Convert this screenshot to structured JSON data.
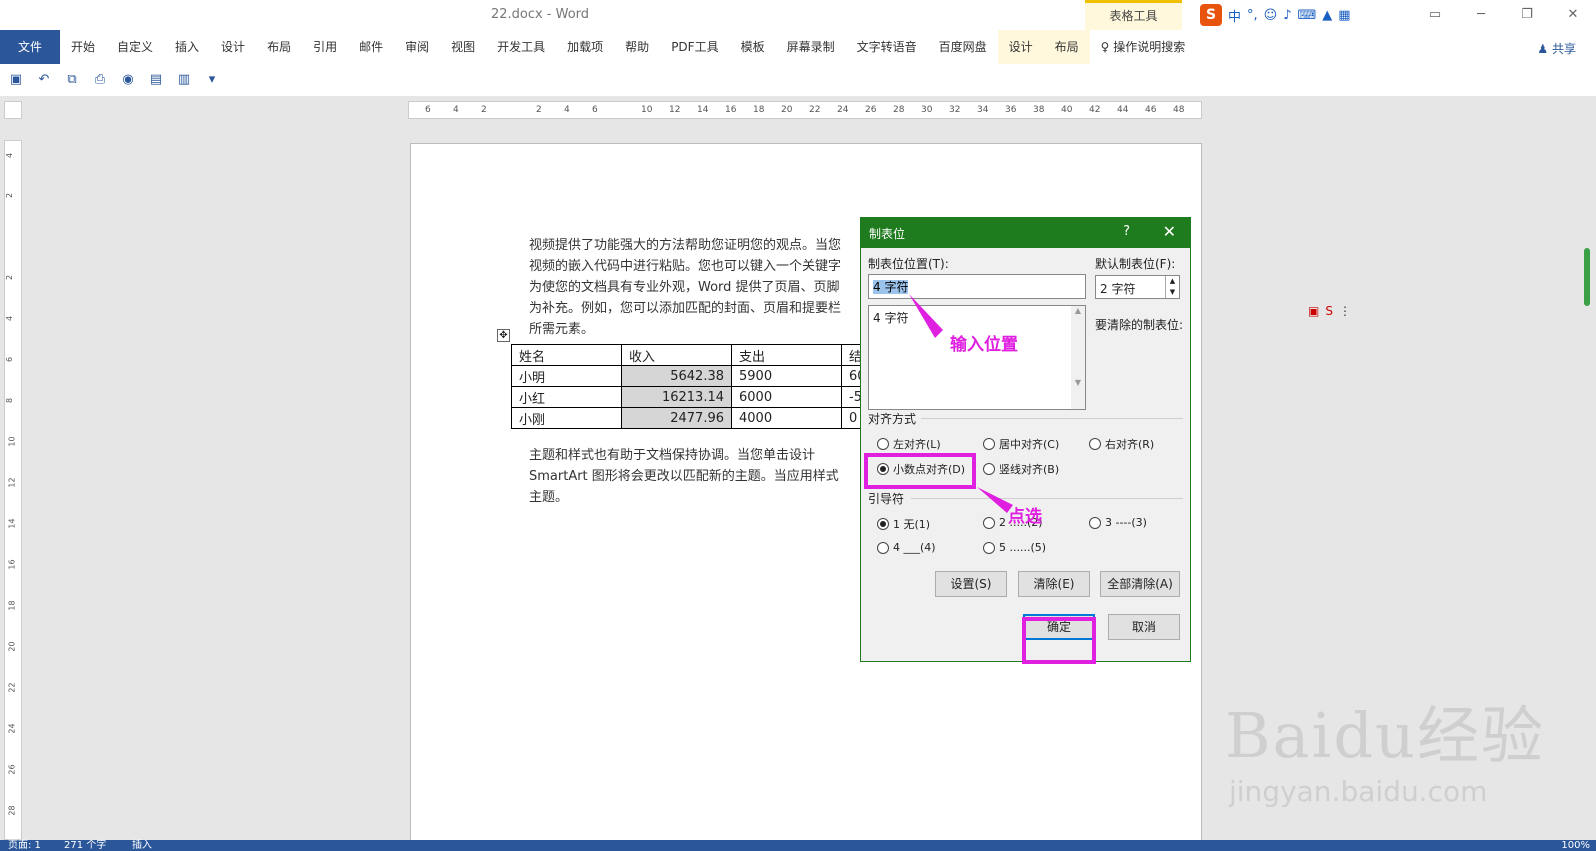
{
  "window": {
    "title": "22.docx  -  Word",
    "context_group": "表格工具"
  },
  "ribbon": {
    "tabs": [
      "文件",
      "开始",
      "自定义",
      "插入",
      "设计",
      "布局",
      "引用",
      "邮件",
      "审阅",
      "视图",
      "开发工具",
      "加载项",
      "帮助",
      "PDF工具",
      "模板",
      "屏幕录制",
      "文字转语音",
      "百度网盘",
      "设计",
      "布局"
    ],
    "tell_me": "操作说明搜索",
    "share": "共享"
  },
  "ime": {
    "mode": "中",
    "punct": "°,"
  },
  "ruler": {
    "h_ticks": [
      "6",
      "4",
      "2",
      "2",
      "4",
      "6",
      "10",
      "12",
      "14",
      "16",
      "18",
      "20",
      "22",
      "24",
      "26",
      "28",
      "30",
      "32",
      "34",
      "36",
      "38",
      "40",
      "42",
      "44",
      "46",
      "48"
    ],
    "v_ticks": [
      "4",
      "2",
      "2",
      "4",
      "6",
      "8",
      "10",
      "12",
      "14",
      "16",
      "18",
      "20",
      "22",
      "24",
      "26",
      "28"
    ]
  },
  "document": {
    "para1": [
      "视频提供了功能强大的方法帮助您证明您的观点。当您",
      "视频的嵌入代码中进行粘贴。您也可以键入一个关键字",
      "为使您的文档具有专业外观，Word 提供了页眉、页脚",
      "为补充。例如，您可以添加匹配的封面、页眉和提要栏",
      "所需元素。"
    ],
    "table": {
      "headers": [
        "姓名",
        "收入",
        "支出",
        "结"
      ],
      "rows": [
        [
          "小明",
          "5642.38",
          "5900",
          "60"
        ],
        [
          "小红",
          "16213.14",
          "6000",
          "-5"
        ],
        [
          "小刚",
          "2477.96",
          "4000",
          "0"
        ]
      ]
    },
    "para2": [
      "主题和样式也有助于文档保持协调。当您单击设计",
      "SmartArt 图形将会更改以匹配新的主题。当应用样式",
      "主题。"
    ]
  },
  "dialog": {
    "title": "制表位",
    "help": "?",
    "close": "✕",
    "tab_position_label": "制表位位置(T):",
    "tab_position_value": "4 字符",
    "tab_list": [
      "4 字符"
    ],
    "default_tab_label": "默认制表位(F):",
    "default_tab_value": "2 字符",
    "clear_label": "要清除的制表位:",
    "alignment_label": "对齐方式",
    "alignment": [
      {
        "label": "左对齐(L)",
        "checked": false
      },
      {
        "label": "居中对齐(C)",
        "checked": false
      },
      {
        "label": "右对齐(R)",
        "checked": false
      },
      {
        "label": "小数点对齐(D)",
        "checked": true
      },
      {
        "label": "竖线对齐(B)",
        "checked": false
      }
    ],
    "leader_label": "引导符",
    "leaders": [
      {
        "label": "1 无(1)",
        "checked": true
      },
      {
        "label": "2 .....(2)",
        "checked": false
      },
      {
        "label": "3 ----(3)",
        "checked": false
      },
      {
        "label": "4 ___(4)",
        "checked": false
      },
      {
        "label": "5 ......(5)",
        "checked": false
      }
    ],
    "btn_set": "设置(S)",
    "btn_clear": "清除(E)",
    "btn_clear_all": "全部清除(A)",
    "btn_ok": "确定",
    "btn_cancel": "取消"
  },
  "annotations": {
    "input_hint": "输入位置",
    "click_hint": "点选",
    "color": "#e020e0"
  },
  "statusbar": {
    "page": "页面: 1",
    "words": "271 个字",
    "mode": "插入",
    "zoom": "100%"
  },
  "watermark": {
    "brand": "Baidu经验",
    "url": "jingyan.baidu.com"
  }
}
